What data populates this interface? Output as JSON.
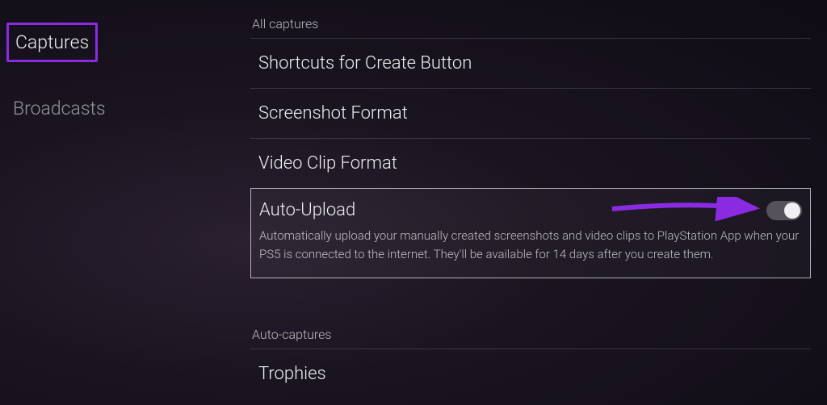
{
  "sidebar": {
    "items": [
      {
        "label": "Captures",
        "active": true
      },
      {
        "label": "Broadcasts",
        "active": false
      }
    ]
  },
  "main": {
    "sections": [
      {
        "header": "All captures",
        "items": [
          {
            "title": "Shortcuts for Create Button"
          },
          {
            "title": "Screenshot Format"
          },
          {
            "title": "Video Clip Format"
          },
          {
            "title": "Auto-Upload",
            "description": "Automatically upload your manually created screenshots and video clips to PlayStation App when your PS5 is connected to the internet. They'll be available for 14 days after you create them.",
            "highlighted": true,
            "toggle": true
          }
        ]
      },
      {
        "header": "Auto-captures",
        "items": [
          {
            "title": "Trophies"
          }
        ]
      }
    ]
  },
  "annotation": {
    "arrow_color": "#8a2be2"
  }
}
